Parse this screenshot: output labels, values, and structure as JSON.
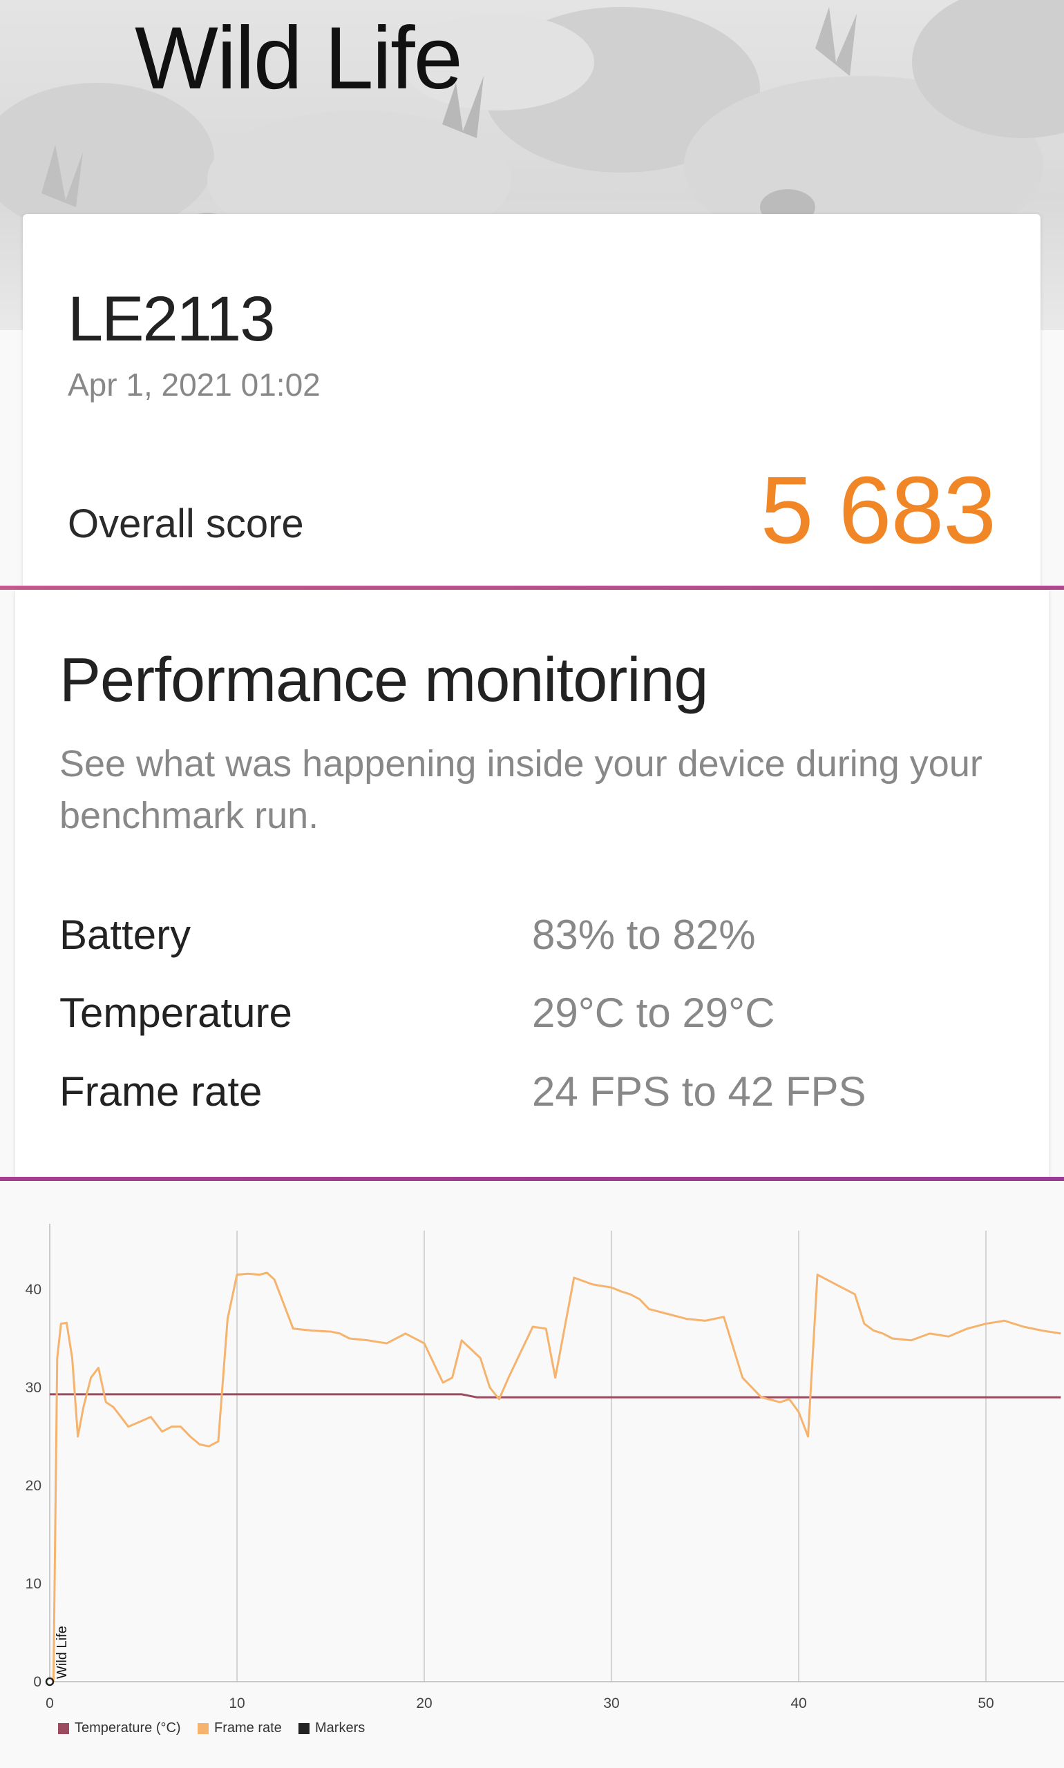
{
  "header": {
    "title": "Wild Life"
  },
  "result": {
    "device": "LE2113",
    "date": "Apr 1, 2021 01:02",
    "score_label": "Overall score",
    "score_value": "5 683"
  },
  "performance": {
    "title": "Performance monitoring",
    "description": "See what was happening inside your device during your benchmark run.",
    "stats": [
      {
        "label": "Battery",
        "value": "83% to 82%"
      },
      {
        "label": "Temperature",
        "value": "29°C to 29°C"
      },
      {
        "label": "Frame rate",
        "value": "24 FPS to 42 FPS"
      }
    ]
  },
  "colors": {
    "score": "#f08626",
    "temperature": "#9c4a5f",
    "frame_rate": "#f5b36e",
    "markers": "#222222",
    "divider": "#b0488f"
  },
  "chart_data": {
    "type": "line",
    "x_ticks": [
      "0",
      "10",
      "20",
      "30",
      "40",
      "50"
    ],
    "y_ticks": [
      "0",
      "10",
      "20",
      "30",
      "40"
    ],
    "xlim": [
      0,
      54
    ],
    "ylim": [
      0,
      46
    ],
    "grid": "vertical",
    "legend_position": "bottom-left",
    "legend": [
      "Temperature (°C)",
      "Frame rate",
      "Markers"
    ],
    "markers": [
      {
        "x": 0,
        "label": "Wild Life"
      }
    ],
    "series": [
      {
        "name": "Temperature (°C)",
        "x": [
          0,
          22,
          22.8,
          54
        ],
        "y": [
          29.3,
          29.3,
          29.0,
          29.0
        ]
      },
      {
        "name": "Frame rate",
        "x": [
          0.2,
          0.4,
          0.6,
          0.9,
          1.2,
          1.5,
          1.8,
          2.2,
          2.6,
          3.0,
          3.4,
          3.8,
          4.2,
          4.8,
          5.4,
          6.0,
          6.5,
          7.0,
          7.5,
          8.0,
          8.5,
          9.0,
          9.5,
          10.0,
          10.6,
          11.2,
          11.6,
          12.0,
          13.0,
          14.0,
          15.0,
          15.5,
          16.0,
          17.0,
          18.0,
          19.0,
          20.0,
          21.0,
          21.5,
          22.0,
          23.0,
          23.5,
          24.0,
          24.5,
          25.0,
          25.8,
          26.5,
          27.0,
          28.0,
          29.0,
          30.0,
          30.5,
          31.0,
          31.5,
          32.0,
          33.0,
          34.0,
          35.0,
          36.0,
          37.0,
          38.0,
          39.0,
          39.5,
          40.0,
          40.5,
          41.0,
          42.0,
          43.0,
          43.5,
          44.0,
          44.5,
          45.0,
          46.0,
          47.0,
          48.0,
          49.0,
          50.0,
          51.0,
          52.0,
          53.0,
          54.0
        ],
        "y": [
          0,
          33,
          36.5,
          36.6,
          33,
          25,
          28,
          31,
          32,
          28.5,
          28,
          27,
          26,
          26.5,
          27,
          25.5,
          26,
          26,
          25,
          24.2,
          24,
          24.5,
          37,
          41.5,
          41.6,
          41.5,
          41.7,
          41,
          36,
          35.8,
          35.7,
          35.5,
          35,
          34.8,
          34.5,
          35.5,
          34.5,
          30.5,
          31,
          34.8,
          33,
          30,
          28.8,
          31,
          33,
          36.2,
          36,
          31,
          41.2,
          40.5,
          40.2,
          39.8,
          39.5,
          39,
          38,
          37.5,
          37,
          36.8,
          37.2,
          31,
          29,
          28.5,
          28.8,
          27.5,
          25,
          41.5,
          40.5,
          39.5,
          36.5,
          35.8,
          35.5,
          35,
          34.8,
          35.5,
          35.2,
          36,
          36.5,
          36.8,
          36.2,
          35.8,
          35.5
        ]
      }
    ]
  }
}
